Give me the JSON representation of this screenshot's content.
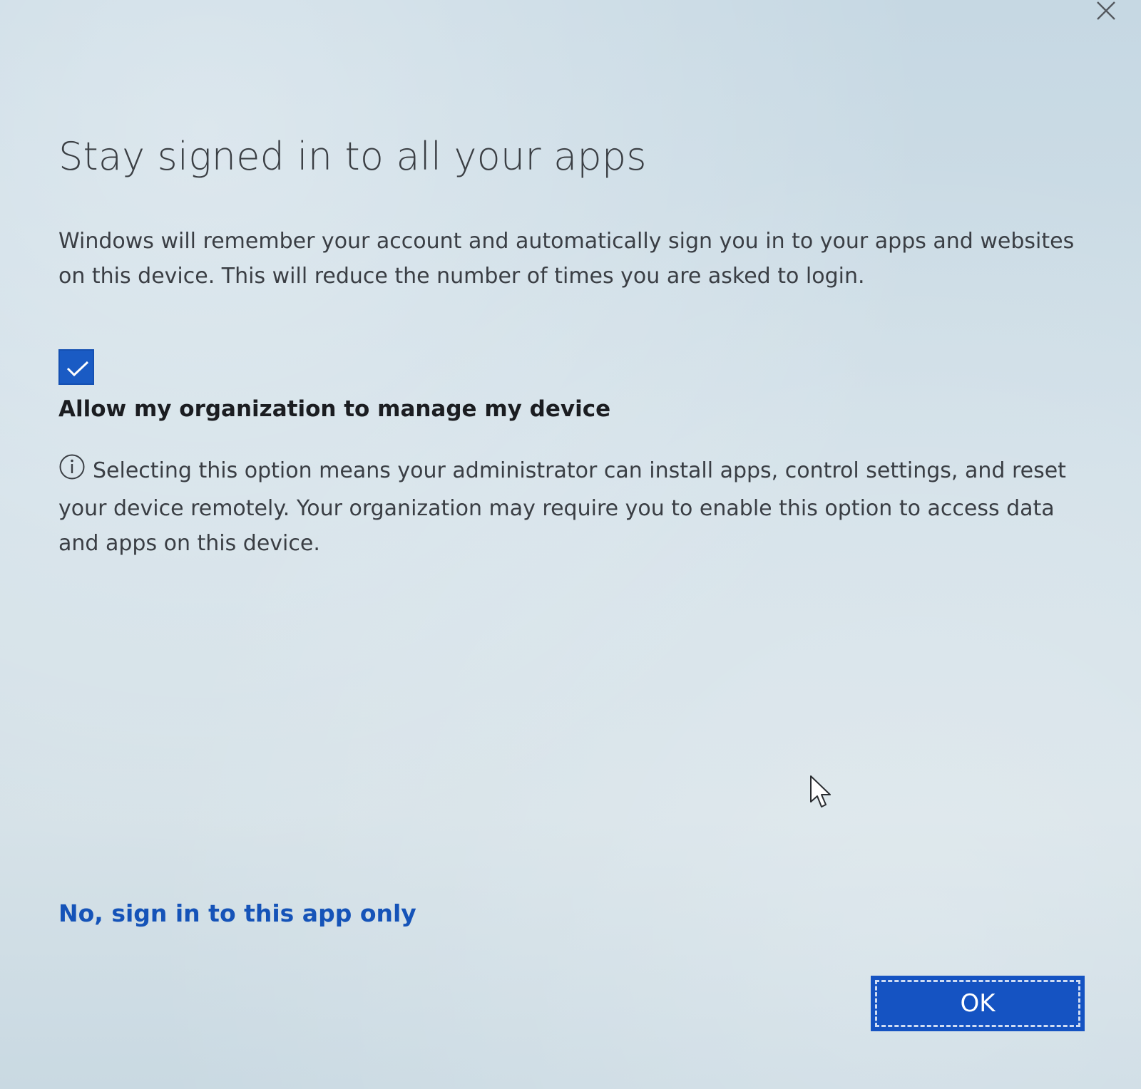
{
  "dialog": {
    "title": "Stay signed in to all your apps",
    "description": "Windows will remember your account and automatically sign you in to your apps and websites on this device. This will reduce the number of times you are asked to login.",
    "close_icon": "close-icon",
    "accent_color": "#1a5bc4"
  },
  "manage_option": {
    "checked": true,
    "label": "Allow my organization to manage my device",
    "info_icon": "info-icon",
    "info_text": "Selecting this option means your administrator can install apps, control settings, and reset your device remotely. Your organization may require you to enable this option to access data and apps on this device."
  },
  "actions": {
    "secondary_link": "No, sign in to this app only",
    "ok_label": "OK"
  }
}
